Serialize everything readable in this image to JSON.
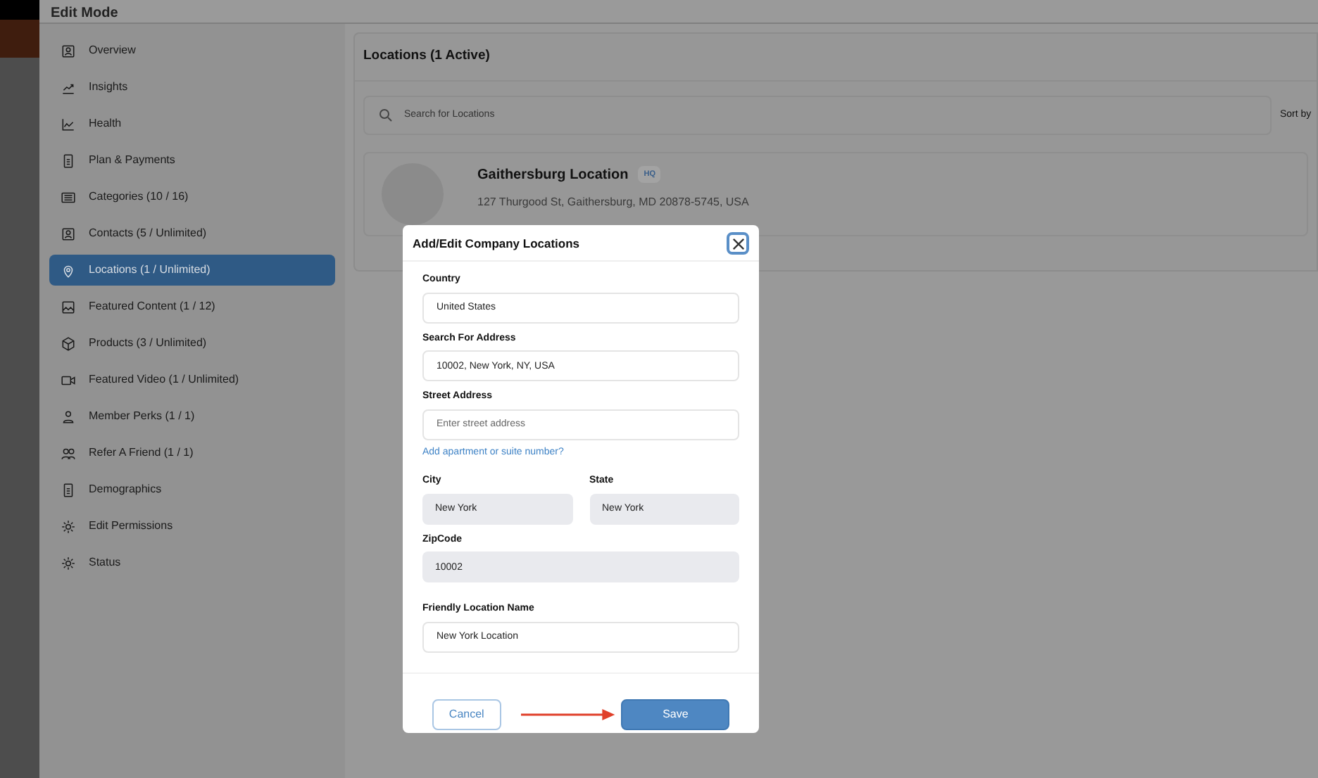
{
  "header": {
    "title": "Edit Mode"
  },
  "sidebar": {
    "items": [
      {
        "label": "Overview",
        "selected": false
      },
      {
        "label": "Insights",
        "selected": false
      },
      {
        "label": "Health",
        "selected": false
      },
      {
        "label": "Plan & Payments",
        "selected": false
      },
      {
        "label": "Categories (10 / 16)",
        "selected": false
      },
      {
        "label": "Contacts (5 / Unlimited)",
        "selected": false
      },
      {
        "label": "Locations (1 / Unlimited)",
        "selected": true
      },
      {
        "label": "Featured Content (1 / 12)",
        "selected": false
      },
      {
        "label": "Products (3 / Unlimited)",
        "selected": false
      },
      {
        "label": "Featured Video (1 / Unlimited)",
        "selected": false
      },
      {
        "label": "Member Perks (1 / 1)",
        "selected": false
      },
      {
        "label": "Refer A Friend (1 / 1)",
        "selected": false
      },
      {
        "label": "Demographics",
        "selected": false
      },
      {
        "label": "Edit Permissions",
        "selected": false
      },
      {
        "label": "Status",
        "selected": false
      }
    ]
  },
  "main": {
    "heading": "Locations (1 Active)",
    "search": {
      "placeholder": "Search for Locations"
    },
    "sort_label": "Sort by",
    "location": {
      "name": "Gaithersburg Location",
      "badge": "HQ",
      "address": "127 Thurgood St, Gaithersburg, MD 20878-5745, USA"
    }
  },
  "dialog": {
    "title": "Add/Edit Company Locations",
    "rows": [
      [
        {
          "label": "Country",
          "value": "United States",
          "kind": "input"
        }
      ],
      [
        {
          "label": "Search For Address",
          "value": "10002, New York, NY, USA",
          "kind": "input"
        }
      ],
      [
        {
          "label": "Street Address",
          "placeholder": "Enter street address",
          "kind": "input"
        }
      ],
      [
        {
          "label": "Add apartment or suite number?",
          "kind": "link"
        }
      ],
      [
        {
          "label": "City",
          "value": "New York",
          "kind": "readonly"
        },
        {
          "label": "State",
          "value": "New York",
          "kind": "readonly"
        }
      ],
      [
        {
          "label": "ZipCode",
          "value": "10002",
          "kind": "readonly"
        }
      ],
      [
        {
          "label": "Friendly Location Name",
          "value": "New York Location",
          "kind": "input"
        }
      ]
    ],
    "cancel": "Cancel",
    "save": "Save"
  }
}
